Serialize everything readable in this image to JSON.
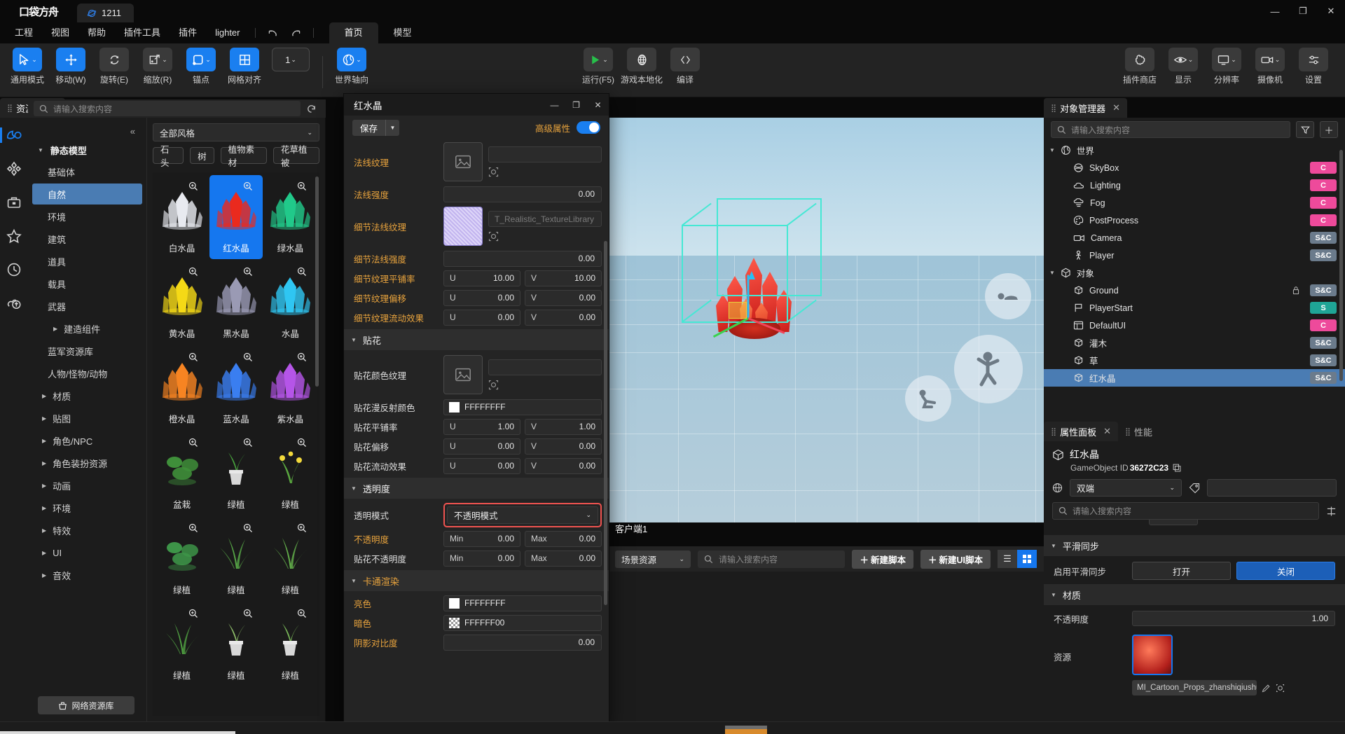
{
  "titlebar": {
    "brand": "口袋方舟",
    "project_tab": "1211",
    "project_icon": "planet-icon",
    "minimize": "—",
    "maximize": "❐",
    "close": "✕"
  },
  "menubar": {
    "items": [
      "工程",
      "视图",
      "帮助",
      "插件工具",
      "插件",
      "lighter"
    ],
    "undo_icon": "undo-icon",
    "redo_icon": "redo-icon",
    "tabs": [
      {
        "label": "首页",
        "active": true
      },
      {
        "label": "模型",
        "active": false
      }
    ]
  },
  "ribbon": {
    "left_tools": [
      {
        "label": "通用模式",
        "icon": "cursor-icon",
        "state": "blue",
        "chevron": true
      },
      {
        "label": "移动(W)",
        "icon": "move-icon",
        "state": "blue",
        "chevron": false
      },
      {
        "label": "旋转(E)",
        "icon": "rotate-icon",
        "state": "grey",
        "chevron": false
      },
      {
        "label": "缩放(R)",
        "icon": "scale-icon",
        "state": "grey",
        "chevron": true
      },
      {
        "label": "锚点",
        "icon": "anchor-icon",
        "state": "blue",
        "chevron": true
      },
      {
        "label": "网格对齐",
        "icon": "grid-icon",
        "state": "blue",
        "chevron": false
      },
      {
        "label": "",
        "icon": "grid-step-value",
        "state": "bordered",
        "value": "1",
        "chevron": true
      },
      {
        "label": "世界轴向",
        "icon": "world-axis-icon",
        "state": "blue",
        "chevron": true
      }
    ],
    "center_tools": [
      {
        "label": "运行(F5)",
        "icon": "play-icon",
        "state": "grey",
        "chevron": true
      },
      {
        "label": "游戏本地化",
        "icon": "globe-icon",
        "state": "grey",
        "chevron": false
      },
      {
        "label": "编译",
        "icon": "code-icon",
        "state": "grey",
        "chevron": false
      }
    ],
    "right_tools": [
      {
        "label": "插件商店",
        "icon": "puzzle-icon",
        "state": "grey",
        "chevron": false
      },
      {
        "label": "显示",
        "icon": "eye-icon",
        "state": "grey",
        "chevron": true
      },
      {
        "label": "分辨率",
        "icon": "monitor-icon",
        "state": "grey",
        "chevron": true
      },
      {
        "label": "摄像机",
        "icon": "camera-icon",
        "state": "grey",
        "chevron": true
      },
      {
        "label": "设置",
        "icon": "sliders-icon",
        "state": "grey",
        "chevron": false
      }
    ]
  },
  "asset_library": {
    "tab_label": "资源库",
    "search_placeholder": "请输入搜索内容",
    "search_value": "",
    "refresh_icon": "refresh-icon",
    "collapse_icon": "collapse-left-icon",
    "rail_icons": [
      "assets-icon",
      "components-icon",
      "toolbox-icon",
      "favorites-icon",
      "recent-icon",
      "upload-icon"
    ],
    "group_label": "静态模型",
    "categories": [
      {
        "label": "基础体",
        "selected": false,
        "expandable": false
      },
      {
        "label": "自然",
        "selected": true,
        "expandable": false
      },
      {
        "label": "环境",
        "selected": false,
        "expandable": false
      },
      {
        "label": "建筑",
        "selected": false,
        "expandable": false
      },
      {
        "label": "道具",
        "selected": false,
        "expandable": false
      },
      {
        "label": "载具",
        "selected": false,
        "expandable": false
      },
      {
        "label": "武器",
        "selected": false,
        "expandable": false
      },
      {
        "label": "建造组件",
        "selected": false,
        "expandable": true,
        "sub": true
      },
      {
        "label": "蓝军资源库",
        "selected": false,
        "expandable": false
      },
      {
        "label": "人物/怪物/动物",
        "selected": false,
        "expandable": false
      },
      {
        "label": "材质",
        "selected": false,
        "expandable": true
      },
      {
        "label": "贴图",
        "selected": false,
        "expandable": true
      },
      {
        "label": "角色/NPC",
        "selected": false,
        "expandable": true
      },
      {
        "label": "角色装扮资源",
        "selected": false,
        "expandable": true
      },
      {
        "label": "动画",
        "selected": false,
        "expandable": true
      },
      {
        "label": "环境",
        "selected": false,
        "expandable": true
      },
      {
        "label": "特效",
        "selected": false,
        "expandable": true
      },
      {
        "label": "UI",
        "selected": false,
        "expandable": true
      },
      {
        "label": "音效",
        "selected": false,
        "expandable": true
      }
    ],
    "network_button": "网络资源库",
    "style_filter": "全部风格",
    "chips": [
      "石头",
      "树",
      "植物素材",
      "花草植被"
    ],
    "items": [
      {
        "name": "白水晶",
        "selected": false,
        "color": "#e8eaf0",
        "shape": "crystal"
      },
      {
        "name": "红水晶",
        "selected": true,
        "color": "#ea2a1e",
        "shape": "crystal"
      },
      {
        "name": "绿水晶",
        "selected": false,
        "color": "#21c98a",
        "shape": "crystal"
      },
      {
        "name": "黄水晶",
        "selected": false,
        "color": "#f5d916",
        "shape": "crystal"
      },
      {
        "name": "黑水晶",
        "selected": false,
        "color": "#9a9ab4",
        "shape": "crystal"
      },
      {
        "name": "水晶",
        "selected": false,
        "color": "#2fc6f2",
        "shape": "crystal"
      },
      {
        "name": "橙水晶",
        "selected": false,
        "color": "#f78422",
        "shape": "crystal"
      },
      {
        "name": "蓝水晶",
        "selected": false,
        "color": "#3a7ef0",
        "shape": "crystal"
      },
      {
        "name": "紫水晶",
        "selected": false,
        "color": "#b555e8",
        "shape": "crystal"
      },
      {
        "name": "盆栽",
        "selected": false,
        "color": "#3f8f3a",
        "shape": "plant"
      },
      {
        "name": "绿植",
        "selected": false,
        "color": "#47a03c",
        "shape": "potted"
      },
      {
        "name": "绿植",
        "selected": false,
        "color": "#5aa840",
        "shape": "flower"
      },
      {
        "name": "绿植",
        "selected": false,
        "color": "#3d9448",
        "shape": "plant"
      },
      {
        "name": "绿植",
        "selected": false,
        "color": "#56a446",
        "shape": "grass"
      },
      {
        "name": "绿植",
        "selected": false,
        "color": "#62ad4a",
        "shape": "grass"
      },
      {
        "name": "绿植",
        "selected": false,
        "color": "#4f9e41",
        "shape": "grass"
      },
      {
        "name": "绿植",
        "selected": false,
        "color": "#8fbf6a",
        "shape": "potted"
      },
      {
        "name": "绿植",
        "selected": false,
        "color": "#7ab959",
        "shape": "potted"
      }
    ]
  },
  "viewport": {
    "tab_label": "客户端1",
    "selection_color": "#45e8d4",
    "hud_buttons": [
      "lie-down-icon",
      "jump-icon",
      "crouch-icon"
    ]
  },
  "bottom_bar": {
    "scope_select": "场景资源",
    "search_placeholder": "请输入搜索内容",
    "search_value": "",
    "new_script": "新建脚本",
    "new_ui_script": "新建UI脚本",
    "list_view_icon": "list-view-icon",
    "grid_view_icon": "grid-view-icon",
    "active_view": "grid"
  },
  "material_dialog": {
    "title": "红水晶",
    "minimize": "—",
    "maximize": "❐",
    "close": "✕",
    "save_label": "保存",
    "advanced_label": "高级属性",
    "advanced_on": true,
    "rows": [
      {
        "kind": "texture",
        "label": "法线纹理",
        "label_style": "orange",
        "filled": false,
        "path": ""
      },
      {
        "kind": "value",
        "label": "法线强度",
        "label_style": "orange",
        "value": "0.00"
      },
      {
        "kind": "texture",
        "label": "细节法线纹理",
        "label_style": "orange",
        "filled": true,
        "path": "T_Realistic_TextureLibrary"
      },
      {
        "kind": "value",
        "label": "细节法线强度",
        "label_style": "orange",
        "value": "0.00"
      },
      {
        "kind": "uv",
        "label": "细节纹理平铺率",
        "label_style": "orange",
        "u": "10.00",
        "v": "10.00"
      },
      {
        "kind": "uv",
        "label": "细节纹理偏移",
        "label_style": "orange",
        "u": "0.00",
        "v": "0.00"
      },
      {
        "kind": "uv",
        "label": "细节纹理流动效果",
        "label_style": "orange",
        "u": "0.00",
        "v": "0.00"
      },
      {
        "kind": "section",
        "label": "贴花",
        "label_style": "plain"
      },
      {
        "kind": "texture",
        "label": "贴花颜色纹理",
        "label_style": "plain",
        "filled": false,
        "path": ""
      },
      {
        "kind": "color",
        "label": "贴花漫反射颜色",
        "label_style": "plain",
        "value": "FFFFFFFF",
        "swatch": "solid"
      },
      {
        "kind": "uv",
        "label": "贴花平铺率",
        "label_style": "plain",
        "u": "1.00",
        "v": "1.00"
      },
      {
        "kind": "uv",
        "label": "贴花偏移",
        "label_style": "plain",
        "u": "0.00",
        "v": "0.00"
      },
      {
        "kind": "uv",
        "label": "贴花流动效果",
        "label_style": "plain",
        "u": "0.00",
        "v": "0.00"
      },
      {
        "kind": "section",
        "label": "透明度",
        "label_style": "plain"
      },
      {
        "kind": "combo",
        "label": "透明模式",
        "label_style": "plain",
        "value": "不透明模式",
        "highlight": true
      },
      {
        "kind": "minmax",
        "label": "不透明度",
        "label_style": "orange",
        "min": "0.00",
        "max": "0.00"
      },
      {
        "kind": "minmax",
        "label": "贴花不透明度",
        "label_style": "plain",
        "min": "0.00",
        "max": "0.00"
      },
      {
        "kind": "section",
        "label": "卡通渲染",
        "label_style": "orange"
      },
      {
        "kind": "color",
        "label": "亮色",
        "label_style": "orange",
        "value": "FFFFFFFF",
        "swatch": "solid"
      },
      {
        "kind": "color",
        "label": "暗色",
        "label_style": "orange",
        "value": "FFFFFF00",
        "swatch": "checker"
      },
      {
        "kind": "value",
        "label": "阴影对比度",
        "label_style": "orange",
        "value": "0.00"
      }
    ],
    "minmax_keys": {
      "min": "Min",
      "max": "Max"
    },
    "uv_keys": {
      "u": "U",
      "v": "V"
    }
  },
  "object_manager": {
    "tab_label": "对象管理器",
    "search_placeholder": "请输入搜索内容",
    "search_value": "",
    "filter_icon": "filter-icon",
    "add_icon": "plus-icon",
    "groups": [
      {
        "label": "世界",
        "icon": "world-icon",
        "children": [
          {
            "label": "SkyBox",
            "icon": "skybox-icon",
            "badge": "C",
            "badge_type": "c"
          },
          {
            "label": "Lighting",
            "icon": "cloud-icon",
            "badge": "C",
            "badge_type": "c"
          },
          {
            "label": "Fog",
            "icon": "fog-icon",
            "badge": "C",
            "badge_type": "c"
          },
          {
            "label": "PostProcess",
            "icon": "palette-icon",
            "badge": "C",
            "badge_type": "c"
          },
          {
            "label": "Camera",
            "icon": "camera-icon",
            "badge": "S&C",
            "badge_type": "sc"
          },
          {
            "label": "Player",
            "icon": "player-icon",
            "badge": "S&C",
            "badge_type": "sc"
          }
        ]
      },
      {
        "label": "对象",
        "icon": "cube-icon",
        "children": [
          {
            "label": "Ground",
            "icon": "mesh-icon",
            "badge": "S&C",
            "badge_type": "sc",
            "locked": true
          },
          {
            "label": "PlayerStart",
            "icon": "flag-icon",
            "badge": "S",
            "badge_type": "s"
          },
          {
            "label": "DefaultUI",
            "icon": "ui-icon",
            "badge": "C",
            "badge_type": "c"
          },
          {
            "label": "灌木",
            "icon": "mesh-icon",
            "badge": "S&C",
            "badge_type": "sc"
          },
          {
            "label": "草",
            "icon": "mesh-icon",
            "badge": "S&C",
            "badge_type": "sc"
          },
          {
            "label": "红水晶",
            "icon": "mesh-icon",
            "badge": "S&C",
            "badge_type": "sc",
            "selected": true
          }
        ]
      }
    ]
  },
  "property_panel": {
    "tabs": [
      {
        "label": "属性面板",
        "active": true,
        "closable": true
      },
      {
        "label": "性能",
        "active": false,
        "closable": false
      }
    ],
    "object_name": "红水晶",
    "object_icon": "cube-icon",
    "id_label": "GameObject ID",
    "id_value": "36272C23",
    "copy_icon": "copy-icon",
    "scope_icon": "globe-icon",
    "scope_value": "双端",
    "tag_icon": "tag-icon",
    "tag_value": "",
    "search_placeholder": "请输入搜索内容",
    "search_value": "",
    "sort_icon": "sort-icon",
    "sections": [
      {
        "label": "平滑同步",
        "rows": [
          {
            "kind": "segment",
            "label": "启用平滑同步",
            "options": [
              "打开",
              "关闭"
            ],
            "selected": 1
          }
        ]
      },
      {
        "label": "材质",
        "rows": [
          {
            "kind": "slider",
            "label": "不透明度",
            "value": "1.00"
          },
          {
            "kind": "resource",
            "label": "资源",
            "path": "MI_Cartoon_Props_zhanshiqiushui",
            "edit_icon": "pencil-icon",
            "locate_icon": "locate-icon"
          }
        ]
      }
    ]
  }
}
